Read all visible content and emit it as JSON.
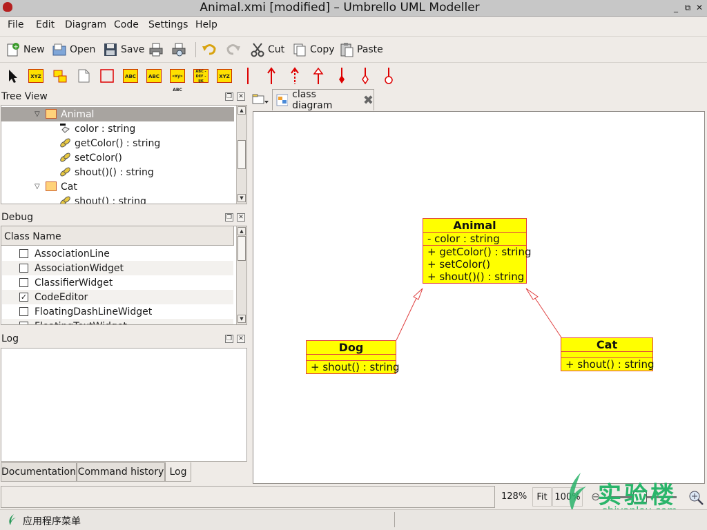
{
  "window": {
    "title": "Animal.xmi [modified] – Umbrello UML Modeller",
    "controls": [
      "_",
      "⧉",
      "✕"
    ]
  },
  "menu": [
    "File",
    "Edit",
    "Diagram",
    "Code",
    "Settings",
    "Help"
  ],
  "toolbar": {
    "new": "New",
    "open": "Open",
    "save": "Save",
    "cut": "Cut",
    "copy": "Copy",
    "paste": "Paste"
  },
  "diagram_tools": {
    "xyz": "XYZ",
    "abc": "ABC",
    "xyz_abc": "«xy» ABC",
    "abc_def": "ABC - DEF - IJK"
  },
  "tree_view": {
    "title": "Tree View",
    "rows": [
      {
        "label": "Animal",
        "kind": "class",
        "selected": true
      },
      {
        "label": "color : string",
        "kind": "attribute"
      },
      {
        "label": "getColor() : string",
        "kind": "operation"
      },
      {
        "label": "setColor()",
        "kind": "operation"
      },
      {
        "label": "shout()() : string",
        "kind": "operation"
      },
      {
        "label": "Cat",
        "kind": "class"
      },
      {
        "label": "shout() : string",
        "kind": "operation"
      }
    ]
  },
  "debug": {
    "title": "Debug",
    "column": "Class Name",
    "rows": [
      {
        "label": "AssociationLine",
        "checked": false
      },
      {
        "label": "AssociationWidget",
        "checked": false
      },
      {
        "label": "ClassifierWidget",
        "checked": false
      },
      {
        "label": "CodeEditor",
        "checked": true
      },
      {
        "label": "FloatingDashLineWidget",
        "checked": false
      },
      {
        "label": "FloatingTextWidget",
        "checked": false
      }
    ]
  },
  "log": {
    "title": "Log"
  },
  "bottom_tabs": [
    "Documentation",
    "Command history",
    "Log"
  ],
  "diagram": {
    "tab_label": "class diagram",
    "classes": {
      "animal": {
        "name": "Animal",
        "attributes": [
          "- color : string"
        ],
        "operations": [
          "+ getColor() : string",
          "+ setColor()",
          "+ shout()() : string"
        ]
      },
      "dog": {
        "name": "Dog",
        "attributes": [],
        "operations": [
          "+ shout() : string"
        ]
      },
      "cat": {
        "name": "Cat",
        "attributes": [],
        "operations": [
          "+ shout() : string"
        ]
      }
    }
  },
  "status": {
    "zoom": "128%",
    "fit": "Fit",
    "hundred": "100%"
  },
  "taskbar": {
    "menu_label": "应用程序菜单"
  },
  "watermark": {
    "chinese": "实验楼",
    "url": "shiyanlou.com"
  },
  "colors": {
    "uml_fill": "#ffff00",
    "uml_border": "#e04040",
    "selection": "#a8a4a0"
  }
}
